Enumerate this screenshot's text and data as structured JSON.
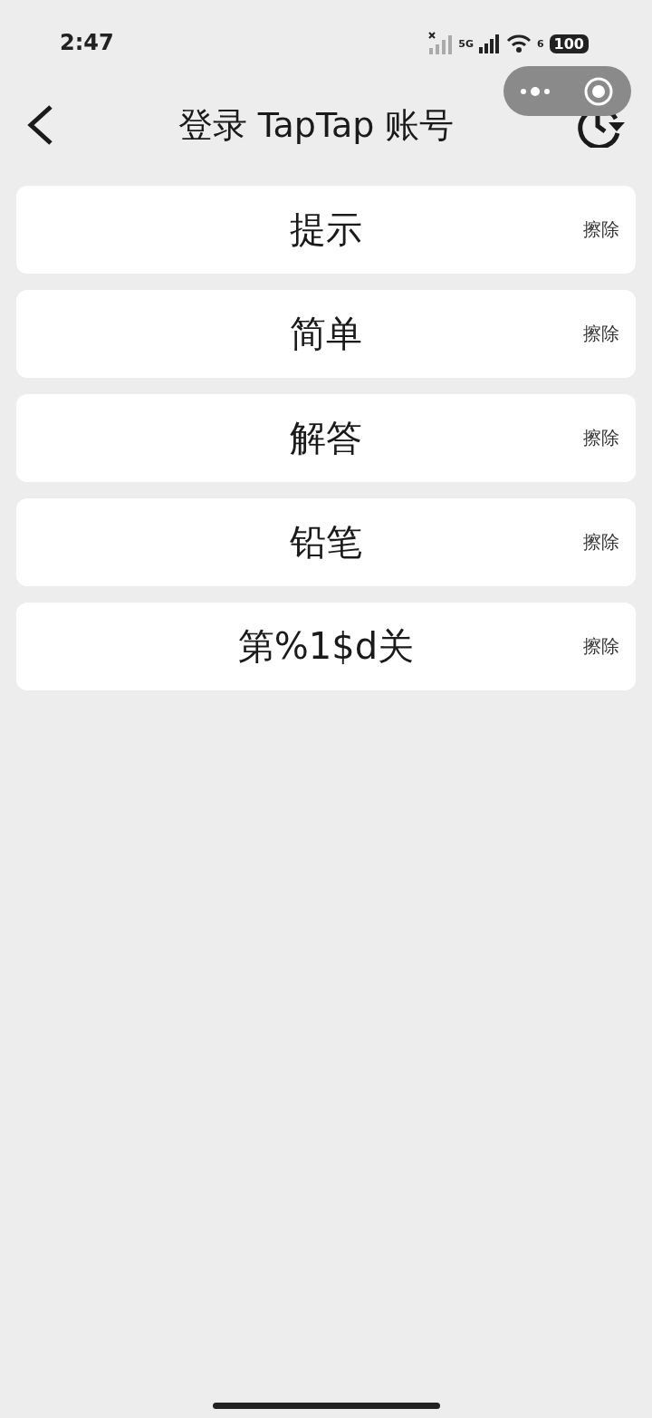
{
  "status_bar": {
    "time": "2:47",
    "network": "5G",
    "wifi_badge": "6",
    "battery": "100"
  },
  "header": {
    "title": "登录 TapTap 账号"
  },
  "items": [
    {
      "label": "提示",
      "action": "擦除"
    },
    {
      "label": "简单",
      "action": "擦除"
    },
    {
      "label": "解答",
      "action": "擦除"
    },
    {
      "label": "铅笔",
      "action": "擦除"
    },
    {
      "label": "第%1$d关",
      "action": "擦除"
    }
  ]
}
